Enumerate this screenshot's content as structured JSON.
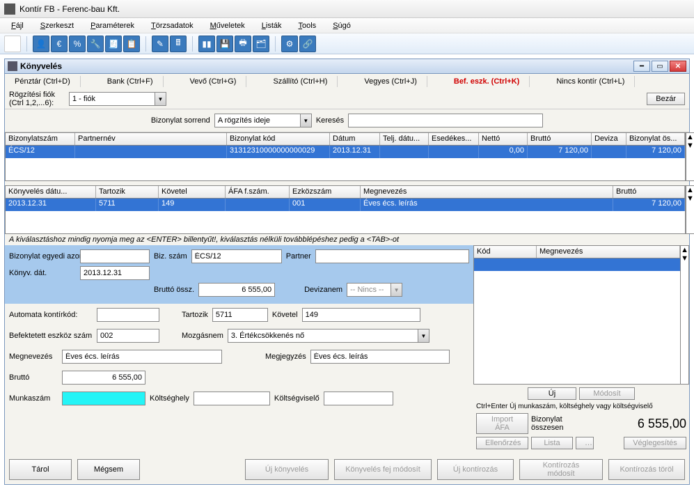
{
  "window": {
    "title": "Kontír FB  - Ferenc-bau Kft."
  },
  "menu": [
    "Fájl",
    "Szerkeszt",
    "Paraméterek",
    "Törzsadatok",
    "Műveletek",
    "Listák",
    "Tools",
    "Súgó"
  ],
  "toolbar_icons": [
    "blank",
    "person",
    "euro",
    "percent",
    "wrench",
    "note",
    "clipboard",
    "edit",
    "calc",
    "chart",
    "save",
    "print",
    "lock",
    "gear",
    "link"
  ],
  "mdi": {
    "title": "Könyvelés",
    "tabs": [
      {
        "label": "Pénztár (Ctrl+D)"
      },
      {
        "label": "Bank (Ctrl+F)"
      },
      {
        "label": "Vevő (Ctrl+G)"
      },
      {
        "label": "Szállító (Ctrl+H)"
      },
      {
        "label": "Vegyes (Ctrl+J)"
      },
      {
        "label": "Bef. eszk. (Ctrl+K)",
        "active": true
      },
      {
        "label": "Nincs kontír (Ctrl+L)"
      }
    ],
    "closeBtn": "Bezár",
    "fiok": {
      "label": "Rögzítési fiók (Ctrl 1,2,...6):",
      "value": "1 - fiók"
    },
    "sort": {
      "label": "Bizonylat sorrend",
      "value": "A rögzítés ideje",
      "search_label": "Keresés",
      "search_value": ""
    },
    "grid1": {
      "headers": [
        "Bizonylatszám",
        "Partnernév",
        "Bizonylat kód",
        "Dátum",
        "Telj. dátu...",
        "Esedékes...",
        "Nettó",
        "Bruttó",
        "Deviza",
        "Bizonylat ös..."
      ],
      "widths": [
        100,
        218,
        148,
        72,
        70,
        72,
        70,
        92,
        50,
        84
      ],
      "row": [
        "ÉCS/12",
        "",
        "31312310000000000029",
        "2013.12.31",
        "",
        "",
        "0,00",
        "7 120,00",
        "",
        "7 120,00"
      ]
    },
    "grid2": {
      "headers": [
        "Könyvelés dátu...",
        "Tartozik",
        "Követel",
        "ÁFA f.szám.",
        "Ezközszám",
        "Megnevezés",
        "Bruttó"
      ],
      "widths": [
        130,
        90,
        96,
        92,
        102,
        363,
        103
      ],
      "row": [
        "2013.12.31",
        "5711",
        "149",
        "",
        "001",
        "Éves écs. leírás",
        "7 120,00"
      ]
    },
    "hint": "A kiválasztáshoz mindig nyomja meg az <ENTER> billentyűt!, kiválasztás nélküli továbblépéshez pedig a <TAB>-ot",
    "form": {
      "egyedi_label": "Bizonylat egyedi azonosító",
      "egyedi": "",
      "bizszam_label": "Biz. szám",
      "bizszam": "ÉCS/12",
      "partner_label": "Partner",
      "partner": "",
      "konyv_label": "Könyv. dát.",
      "konyv": "2013.12.31",
      "brutto_label": "Bruttó össz.",
      "brutto": "6 555,00",
      "deviza_label": "Devizanem",
      "deviza": "-- Nincs --",
      "autokontir_label": "Automata kontírkód:",
      "autokontir": "",
      "tartozik_label": "Tartozik",
      "tartozik": "5711",
      "kovetel_label": "Követel",
      "kovetel": "149",
      "befekt_label": "Befektetett eszköz szám",
      "befekt": "002",
      "mozgas_label": "Mozgásnem",
      "mozgas": "3. Értékcsökkenés nő",
      "megn_label": "Megnevezés",
      "megn": "Éves écs. leírás",
      "megj_label": "Megjegyzés",
      "megj": "Éves écs. leírás",
      "brutto2_label": "Bruttó",
      "brutto2": "6 555,00",
      "munka_label": "Munkaszám",
      "munka": "",
      "koltseghely_label": "Költséghely",
      "koltseghely": "",
      "koltsegviselo_label": "Költségviselő",
      "koltsegviselo": ""
    },
    "rightgrid": {
      "headers": [
        "Kód",
        "Megnevezés"
      ]
    },
    "rightactions": {
      "uj": "Új",
      "modosit": "Módosít",
      "hint": "Ctrl+Enter Új munkaszám, költséghely vagy költségviselő",
      "importafa": "Import ÁFA",
      "bizossz_label": "Bizonylat összesen",
      "bizossz": "6 555,00",
      "ellenorzes": "Ellenőrzés",
      "lista": "Lista",
      "veglegesites": "Véglegesítés"
    },
    "bottom": {
      "tarol": "Tárol",
      "megsem": "Mégsem",
      "ujkonyv": "Új könyvelés",
      "fejmod": "Könyvelés fej módosít",
      "ujkontir": "Új kontírozás",
      "kontirmod": "Kontírozás módosít",
      "kontirtor": "Kontírozás töröl"
    }
  }
}
